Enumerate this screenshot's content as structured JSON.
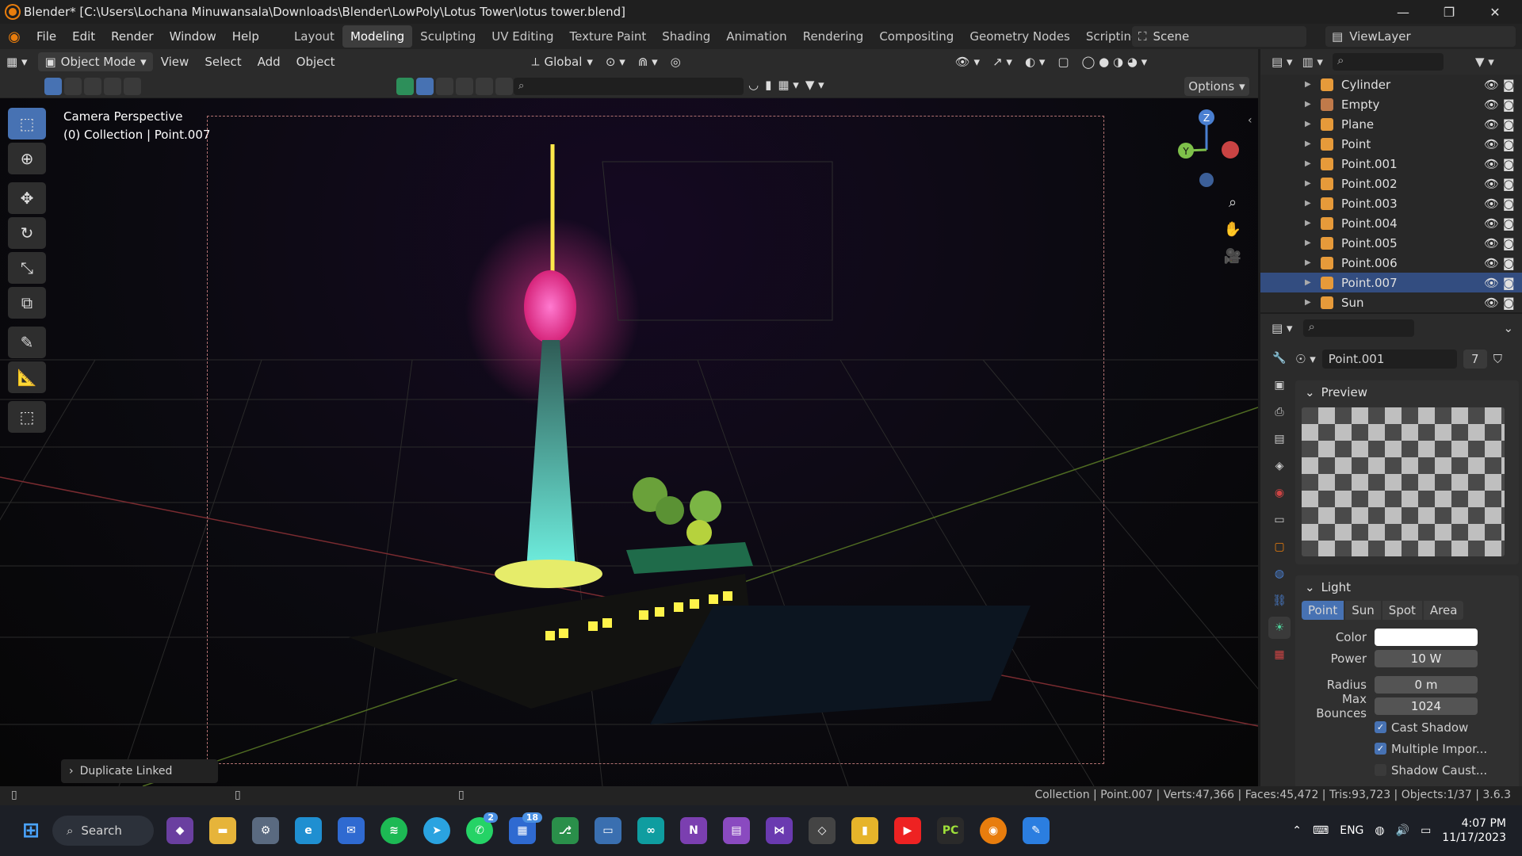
{
  "window": {
    "title": "Blender* [C:\\Users\\Lochana Minuwansala\\Downloads\\Blender\\LowPoly\\Lotus Tower\\lotus tower.blend]"
  },
  "menus": [
    "File",
    "Edit",
    "Render",
    "Window",
    "Help"
  ],
  "workspaces": [
    "Layout",
    "Modeling",
    "Sculpting",
    "UV Editing",
    "Texture Paint",
    "Shading",
    "Animation",
    "Rendering",
    "Compositing",
    "Geometry Nodes",
    "Scripting"
  ],
  "active_workspace": "Modeling",
  "scene": {
    "label": "Scene",
    "view_layer": "ViewLayer"
  },
  "header": {
    "mode": "Object Mode",
    "view": "View",
    "select": "Select",
    "add": "Add",
    "object": "Object",
    "transform": "Global",
    "options": "Options"
  },
  "viewport": {
    "info_line1": "Camera Perspective",
    "info_line2": "(0) Collection | Point.007",
    "last_operator": "Duplicate Linked"
  },
  "outliner": {
    "items": [
      {
        "name": "Cylinder",
        "type": "mesh"
      },
      {
        "name": "Empty",
        "type": "empty"
      },
      {
        "name": "Plane",
        "type": "mesh"
      },
      {
        "name": "Point",
        "type": "light"
      },
      {
        "name": "Point.001",
        "type": "light"
      },
      {
        "name": "Point.002",
        "type": "light"
      },
      {
        "name": "Point.003",
        "type": "light"
      },
      {
        "name": "Point.004",
        "type": "light"
      },
      {
        "name": "Point.005",
        "type": "light"
      },
      {
        "name": "Point.006",
        "type": "light"
      },
      {
        "name": "Point.007",
        "type": "light",
        "selected": true
      },
      {
        "name": "Sun",
        "type": "light"
      }
    ]
  },
  "properties": {
    "datablock": "Point.001",
    "users": "7",
    "preview_label": "Preview",
    "light_label": "Light",
    "light_types": [
      "Point",
      "Sun",
      "Spot",
      "Area"
    ],
    "active_type": "Point",
    "color_label": "Color",
    "color_value": "#ffffff",
    "power_label": "Power",
    "power": "10 W",
    "radius_label": "Radius",
    "radius": "0 m",
    "bounces_label": "Max Bounces",
    "bounces": "1024",
    "cast_shadow": "Cast Shadow",
    "multiple_importance": "Multiple Impor...",
    "shadow_caustics": "Shadow Caust..."
  },
  "status": {
    "stats": "Collection | Point.007 | Verts:47,366 | Faces:45,472 | Tris:93,723 | Objects:1/37 | 3.6.3"
  },
  "taskbar": {
    "search": "Search",
    "lang": "ENG",
    "time": "4:07 PM",
    "date": "11/17/2023",
    "whatsapp_badge": "2",
    "teams_badge": "18"
  },
  "colors": {
    "accent": "#4772b3",
    "selection": "#334d80",
    "blender_orange": "#e87d0d"
  }
}
